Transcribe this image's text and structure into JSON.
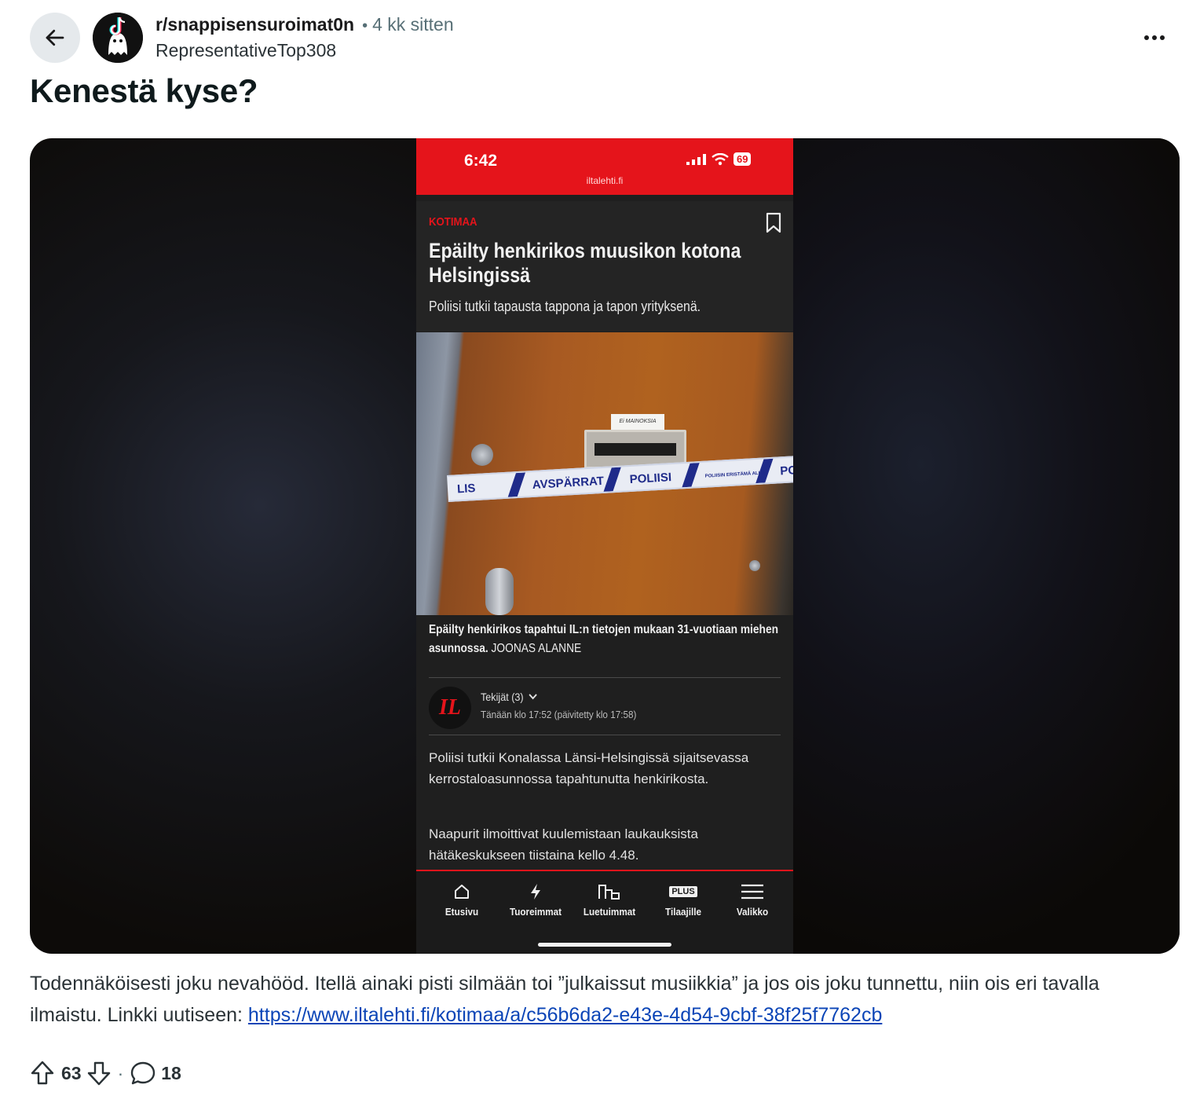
{
  "header": {
    "subreddit": "r/snappisensuroimat0n",
    "separator": "•",
    "time_ago": "4 kk sitten",
    "author": "RepresentativeTop308"
  },
  "post": {
    "title": "Kenestä kyse?",
    "body_text": "Todennäköisesti joku nevahööd. Itellä ainaki pisti silmään toi ”julkaissut musiikkia” ja jos ois joku tunnettu, niin ois eri tavalla ilmaistu. Linkki uutiseen: ",
    "link_text": "https://www.iltalehti.fi/kotimaa/a/c56b6da2-e43e-4d54-9cbf-38f25f7762cb",
    "upvotes": "63",
    "comments": "18",
    "dot": "·"
  },
  "screenshot": {
    "clock": "6:42",
    "battery": "69",
    "domain": "iltalehti.fi",
    "category": "KOTIMAA",
    "headline": "Epäilty henkirikos muusikon kotona Helsingissä",
    "lede": "Poliisi tutkii tapausta tappona ja tapon yrityksenä.",
    "photo_sign": "Ei MAINOKSIA",
    "tape_words": [
      "LIS",
      "AVSPÄRRAT",
      "POLIISI",
      "POLIISIN ERISTÄMÄ ALUE",
      "POLIS"
    ],
    "caption": "Epäilty henkirikos tapahtui IL:n tietojen mukaan 31-vuotiaan miehen asunnossa.",
    "caption_credit": "JOONAS ALANNE",
    "logo_text": "IL",
    "authors": "Tekijät (3)",
    "dateline": "Tänään klo 17:52 (päivitetty klo 17:58)",
    "paragraph1": "Poliisi tutkii Konalassa Länsi-Helsingissä sijaitsevassa kerrostaloasunnossa tapahtunutta henkirikosta.",
    "paragraph2": "Naapurit ilmoittivat kuulemistaan laukauksista hätäkeskukseen tiistaina kello 4.48.",
    "nav": [
      {
        "label": "Etusivu",
        "icon": "home-icon"
      },
      {
        "label": "Tuoreimmat",
        "icon": "lightning-icon"
      },
      {
        "label": "Luetuimmat",
        "icon": "bar-chart-icon"
      },
      {
        "label": "Tilaajille",
        "icon": "plus-badge-icon",
        "badge": "PLUS"
      },
      {
        "label": "Valikko",
        "icon": "menu-icon"
      }
    ]
  },
  "colors": {
    "il_red": "#e5141b",
    "link_blue": "#0b45b7",
    "tape_blue": "#1f2b8a"
  }
}
